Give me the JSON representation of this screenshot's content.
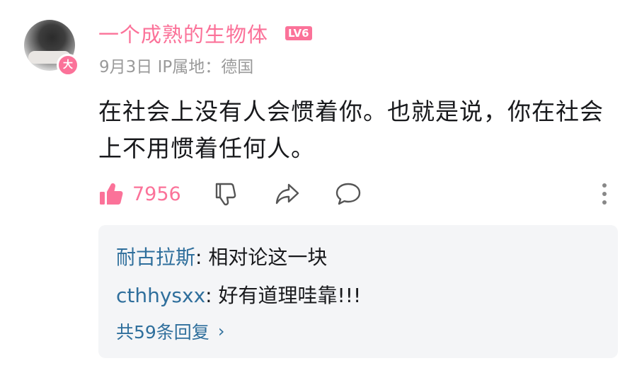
{
  "user": {
    "name": "一个成熟的生物体",
    "level": "LV6",
    "badge": "大",
    "date": "9月3日",
    "ip_location": "IP属地：德国"
  },
  "comment": {
    "text": "在社会上没有人会惯着你。也就是说，你在社会上不用惯着任何人。"
  },
  "actions": {
    "like_count": "7956"
  },
  "replies": {
    "items": [
      {
        "author": "耐古拉斯",
        "text": ": 相对论这一块"
      },
      {
        "author": "cthhysxx",
        "text": ": 好有道理哇靠!!!"
      }
    ],
    "more_label": "共59条回复",
    "more_chevron": "›"
  },
  "colors": {
    "accent_pink": "#fb7299",
    "reply_name_blue": "#2f6f9c",
    "meta_gray": "#9a9a9a",
    "reply_bg": "#f4f5f7"
  }
}
